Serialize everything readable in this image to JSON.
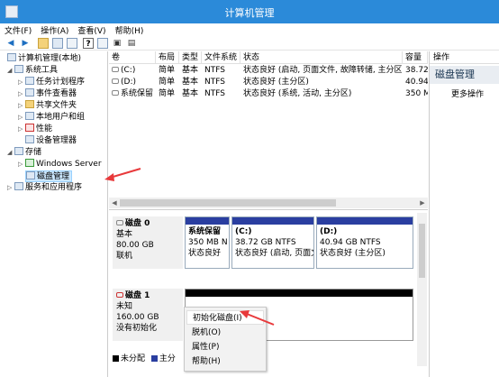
{
  "window": {
    "title": "计算机管理"
  },
  "menu": [
    "文件(F)",
    "操作(A)",
    "查看(V)",
    "帮助(H)"
  ],
  "toolbar_icons": [
    "back-icon",
    "forward-icon",
    "up-folder-icon",
    "show-tree-icon",
    "properties-icon",
    "help-icon",
    "refresh-icon",
    "export-icon",
    "details-icon"
  ],
  "tree": {
    "root": "计算机管理(本地)",
    "system_tools": "系统工具",
    "task_scheduler": "任务计划程序",
    "event_viewer": "事件查看器",
    "shared_folders": "共享文件夹",
    "local_users": "本地用户和组",
    "performance": "性能",
    "device_manager": "设备管理器",
    "storage": "存储",
    "windows_server_backup": "Windows Server",
    "disk_management": "磁盘管理",
    "services_apps": "服务和应用程序"
  },
  "list": {
    "headers": [
      "卷",
      "布局",
      "类型",
      "文件系统",
      "状态",
      "容量"
    ],
    "rows": [
      [
        "(C:)",
        "简单",
        "基本",
        "NTFS",
        "状态良好 (启动, 页面文件, 故障转储, 主分区)",
        "38.72"
      ],
      [
        "(D:)",
        "简单",
        "基本",
        "NTFS",
        "状态良好 (主分区)",
        "40.94"
      ],
      [
        "系统保留",
        "简单",
        "基本",
        "NTFS",
        "状态良好 (系统, 活动, 主分区)",
        "350 M"
      ]
    ]
  },
  "disk0": {
    "name": "磁盘 0",
    "type": "基本",
    "size": "80.00 GB",
    "status": "联机",
    "partitions": [
      {
        "name": "系统保留",
        "size": "350 MB N",
        "status": "状态良好"
      },
      {
        "name": "(C:)",
        "size": "38.72 GB NTFS",
        "status": "状态良好 (启动, 页面文"
      },
      {
        "name": "(D:)",
        "size": "40.94 GB NTFS",
        "status": "状态良好 (主分区)"
      }
    ]
  },
  "disk1": {
    "name": "磁盘 1",
    "type": "未知",
    "size": "160.00 GB",
    "status": "没有初始化"
  },
  "legend": {
    "unallocated": "未分配",
    "primary": "主分"
  },
  "context_menu": [
    "初始化磁盘(I)",
    "脱机(O)",
    "属性(P)",
    "帮助(H)"
  ],
  "actions": {
    "header": "操作",
    "section": "磁盘管理",
    "more": "更多操作"
  },
  "colors": {
    "titlebar": "#2b8ad9",
    "primary_partition": "#2a3ea0",
    "unallocated": "#000000",
    "annotation_arrow": "#e8393b"
  }
}
